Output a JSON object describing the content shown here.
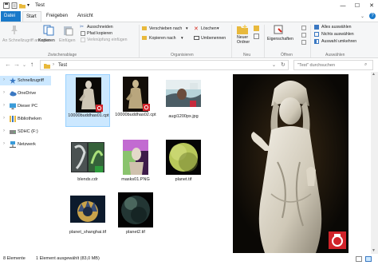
{
  "window": {
    "title": "Test",
    "colors": {
      "accent": "#1979ca",
      "selection": "#cce8ff"
    }
  },
  "tabs": [
    "Datei",
    "Start",
    "Freigeben",
    "Ansicht"
  ],
  "ribbon": {
    "pin_label": "An Schnellzugriff anheften",
    "copy_label": "Kopieren",
    "paste_label": "Einfügen",
    "cut_label": "Ausschneiden",
    "copy_path_label": "Pfad kopieren",
    "paste_shortcut_label": "Verknüpfung einfügen",
    "clipboard_group": "Zwischenablage",
    "move_to_label": "Verschieben nach",
    "copy_to_label": "Kopieren nach",
    "delete_label": "Löschen",
    "rename_label": "Umbenennen",
    "organize_group": "Organisieren",
    "new_folder_label": "Neuer Ordner",
    "new_group": "Neu",
    "properties_label": "Eigenschaften",
    "open_group": "Öffnen",
    "select_all_label": "Alles auswählen",
    "select_none_label": "Nichts auswählen",
    "invert_selection_label": "Auswahl umkehren",
    "select_group": "Auswählen"
  },
  "address": {
    "path": "Test",
    "search_placeholder": "\"Test\" durchsuchen"
  },
  "nav": [
    {
      "label": "Schnellzugriff",
      "icon": "star-icon"
    },
    {
      "label": "OneDrive",
      "icon": "cloud-icon"
    },
    {
      "label": "Dieser PC",
      "icon": "computer-icon"
    },
    {
      "label": "Bibliotheken",
      "icon": "library-icon"
    },
    {
      "label": "SDHC (F:)",
      "icon": "drive-icon"
    },
    {
      "label": "Netzwerk",
      "icon": "network-icon"
    }
  ],
  "files": [
    {
      "name": "10000buddhas01.cpt",
      "selected": true
    },
    {
      "name": "10000buddhas02.cpt",
      "selected": false
    },
    {
      "name": "augi1200px.jpg",
      "selected": false
    },
    {
      "name": "blends.cdr",
      "selected": false
    },
    {
      "name": "masks01.PNG",
      "selected": false
    },
    {
      "name": "planet.tif",
      "selected": false
    },
    {
      "name": "planet_shanghai.tif",
      "selected": false
    },
    {
      "name": "planet2.tif",
      "selected": false
    }
  ],
  "status": {
    "count": "8 Elemente",
    "selection": "1 Element ausgewählt (83,0 MB)"
  }
}
